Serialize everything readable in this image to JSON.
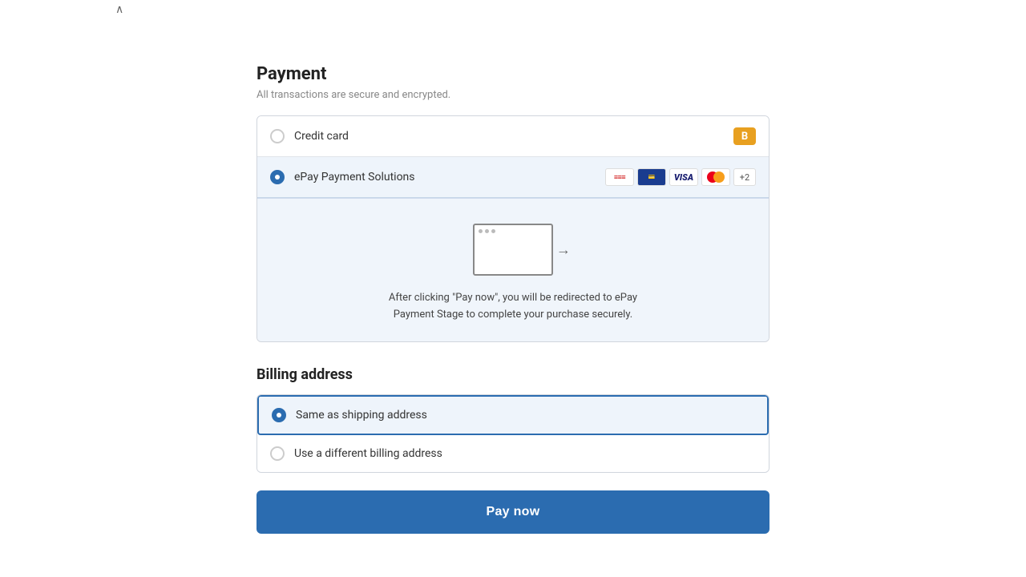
{
  "chevron": "∧",
  "payment": {
    "title": "Payment",
    "subtitle": "All transactions are secure and encrypted.",
    "options": [
      {
        "id": "credit-card",
        "label": "Credit card",
        "selected": false,
        "icon": "B"
      },
      {
        "id": "epay",
        "label": "ePay Payment Solutions",
        "selected": true
      }
    ],
    "epay_redirect_text_line1": "After clicking \"Pay now\", you will be redirected to ePay",
    "epay_redirect_text_line2": "Payment Stage to complete your purchase securely."
  },
  "billing": {
    "title": "Billing address",
    "options": [
      {
        "id": "same",
        "label": "Same as shipping address",
        "selected": true
      },
      {
        "id": "different",
        "label": "Use a different billing address",
        "selected": false
      }
    ]
  },
  "pay_button": {
    "label": "Pay now"
  },
  "icons": {
    "stripe_label": "≡≡",
    "visa_label": "VISA",
    "mc_label": "",
    "more_label": "+2",
    "b_label": "B"
  }
}
